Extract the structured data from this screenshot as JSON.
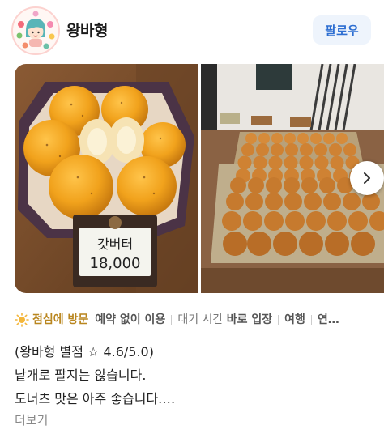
{
  "header": {
    "username": "왕바형",
    "follow_label": "팔로우",
    "avatar_icon": "avatar-icon"
  },
  "photos": [
    {
      "name": "photo-bread-box",
      "price_sign": {
        "line1": "갓버터",
        "line2": "18,000"
      }
    },
    {
      "name": "photo-bread-trays"
    }
  ],
  "carousel": {
    "next_icon": "chevron-right-icon"
  },
  "tags": {
    "icon": "sun-icon",
    "highlight": "점심에 방문",
    "items": [
      {
        "label": "예약 없이 이용",
        "value": ""
      },
      {
        "label": "대기 시간",
        "value": "바로 입장"
      },
      {
        "label": "여행",
        "value": ""
      },
      {
        "label": "연…",
        "value": ""
      }
    ]
  },
  "review": {
    "lines": [
      "(왕바형 별점 ☆ 4.6/5.0)",
      "낱개로 팔지는 않습니다.",
      "도너츠 맛은 아주 좋습니다.…"
    ],
    "more_label": "더보기"
  },
  "colors": {
    "follow_bg": "#eef4fc",
    "follow_text": "#2d6ed1",
    "highlight": "#b9861f"
  }
}
